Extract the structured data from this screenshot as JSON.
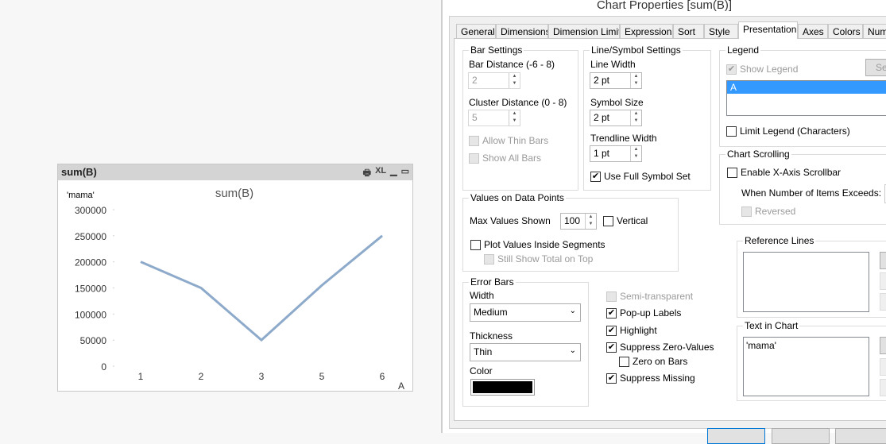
{
  "chart_object": {
    "caption": "sum(B)",
    "caption_icons": [
      "print-icon",
      "xl-icon",
      "minimize-icon",
      "maximize-icon"
    ],
    "xl_label": "XL"
  },
  "chart_data": {
    "type": "line",
    "title": "sum(B)",
    "text_in_chart": "'mama'",
    "xlabel": "A",
    "ylabel": "",
    "categories": [
      "1",
      "2",
      "3",
      "5",
      "6"
    ],
    "values": [
      200000,
      150000,
      50000,
      155000,
      250000
    ],
    "yticks": [
      "0",
      "50000",
      "100000",
      "150000",
      "200000",
      "250000",
      "300000"
    ],
    "ylim": [
      0,
      300000
    ],
    "grid": false,
    "line_color": "#8eaacb"
  },
  "dialog": {
    "title": "Chart Properties [sum(B)]",
    "tabs": [
      "General",
      "Dimensions",
      "Dimension Limits",
      "Expressions",
      "Sort",
      "Style",
      "Presentation",
      "Axes",
      "Colors",
      "Numb"
    ],
    "active_tab": "Presentation",
    "bar_settings": {
      "title": "Bar Settings",
      "bar_distance_label": "Bar Distance (-6 - 8)",
      "bar_distance": "2",
      "cluster_distance_label": "Cluster Distance (0 - 8)",
      "cluster_distance": "5",
      "allow_thin_bars": "Allow Thin Bars",
      "show_all_bars": "Show All Bars"
    },
    "line_symbol": {
      "title": "Line/Symbol Settings",
      "line_width_label": "Line Width",
      "line_width": "2 pt",
      "symbol_size_label": "Symbol Size",
      "symbol_size": "2 pt",
      "trendline_width_label": "Trendline Width",
      "trendline_width": "1 pt",
      "use_full_symbol_set": "Use Full Symbol Set"
    },
    "legend": {
      "title": "Legend",
      "show_legend": "Show Legend",
      "settings_btn": "Set",
      "items": [
        "A"
      ],
      "limit_legend": "Limit Legend (Characters)"
    },
    "chart_scrolling": {
      "title": "Chart Scrolling",
      "enable": "Enable X-Axis Scrollbar",
      "when_exceeds": "When Number of Items Exceeds:",
      "reversed": "Reversed"
    },
    "values_on_points": {
      "title": "Values on Data Points",
      "max_values_label": "Max Values Shown",
      "max_values": "100",
      "vertical": "Vertical",
      "plot_inside": "Plot Values Inside Segments",
      "still_show_total": "Still Show Total on Top"
    },
    "error_bars": {
      "title": "Error Bars",
      "width_label": "Width",
      "width": "Medium",
      "thickness_label": "Thickness",
      "thickness": "Thin",
      "color_label": "Color",
      "color": "#000000"
    },
    "misc": {
      "semi_transparent": "Semi-transparent",
      "popup_labels": "Pop-up Labels",
      "highlight": "Highlight",
      "suppress_zero": "Suppress Zero-Values",
      "zero_on_bars": "Zero on Bars",
      "suppress_missing": "Suppress Missing"
    },
    "reference_lines": {
      "title": "Reference Lines"
    },
    "text_in_chart": {
      "title": "Text in Chart",
      "items": [
        "'mama'"
      ]
    }
  }
}
